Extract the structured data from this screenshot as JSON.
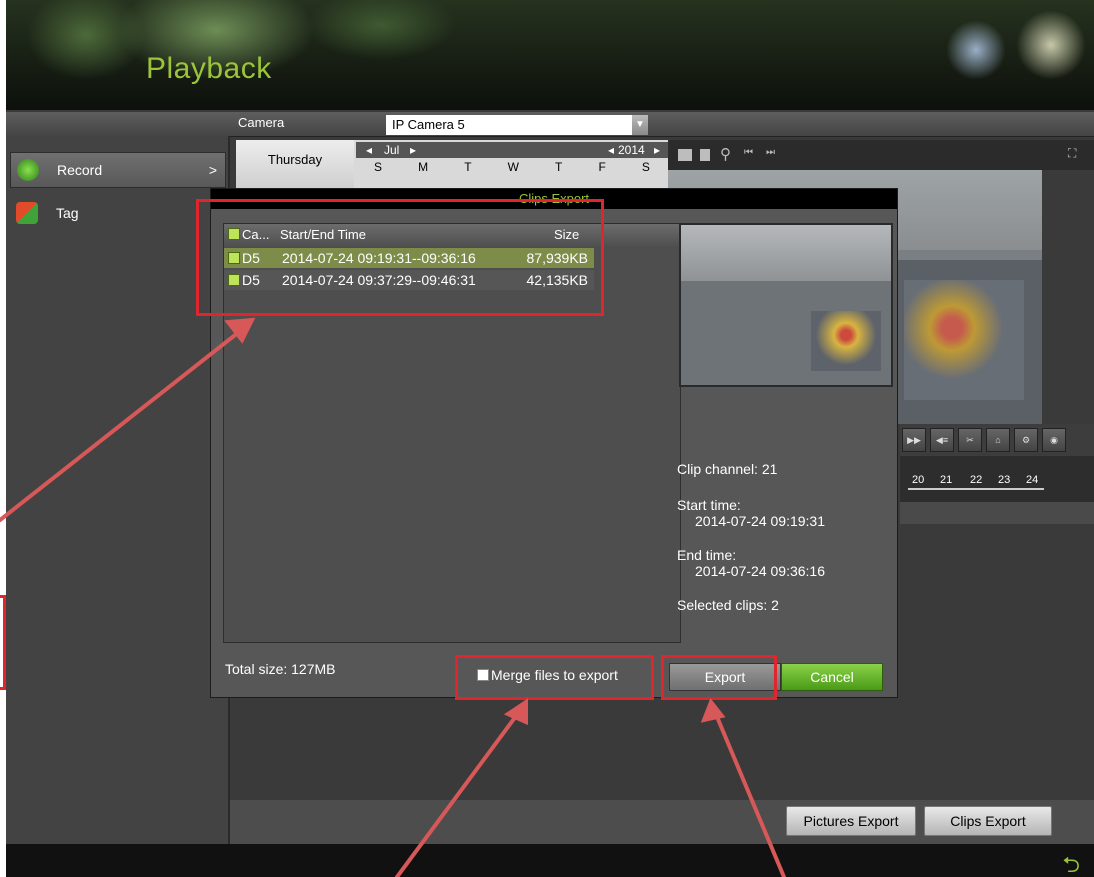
{
  "app": {
    "title": "Playback"
  },
  "header": {
    "camera_label": "Camera",
    "camera_value": "IP Camera 5"
  },
  "sidebar": {
    "items": [
      {
        "label": "Record",
        "chevron": ">"
      },
      {
        "label": "Tag"
      }
    ]
  },
  "calendar": {
    "weekday": "Thursday",
    "month": "Jul",
    "year": "2014",
    "weekdays": [
      "S",
      "M",
      "T",
      "W",
      "T",
      "F",
      "S"
    ]
  },
  "dialog": {
    "title": "Clips Export",
    "columns": [
      "Ca...",
      "Start/End Time",
      "Size"
    ],
    "rows": [
      {
        "camera": "D5",
        "time": "2014-07-24 09:19:31--09:36:16",
        "size": "87,939KB",
        "checked": true
      },
      {
        "camera": "D5",
        "time": "2014-07-24 09:37:29--09:46:31",
        "size": "42,135KB",
        "checked": true
      }
    ],
    "info": {
      "clip_channel": "Clip channel: 21",
      "start_label": "Start time:",
      "start_value": "2014-07-24 09:19:31",
      "end_label": "End time:",
      "end_value": "2014-07-24 09:36:16",
      "selected": "Selected clips: 2"
    },
    "total_size": "Total size: 127MB",
    "merge_label": "Merge files to export",
    "export_label": "Export",
    "cancel_label": "Cancel"
  },
  "timeline": {
    "ticks": [
      "20",
      "21",
      "22",
      "23",
      "24"
    ]
  },
  "bottom": {
    "pictures_export": "Pictures Export",
    "clips_export": "Clips Export"
  },
  "colors": {
    "accent": "#9cc43a",
    "highlight": "#e0262c",
    "cancel": "#5aac22"
  },
  "icons": [
    "record-icon",
    "tag-icon",
    "back-icon",
    "dropdown-arrow-icon"
  ]
}
